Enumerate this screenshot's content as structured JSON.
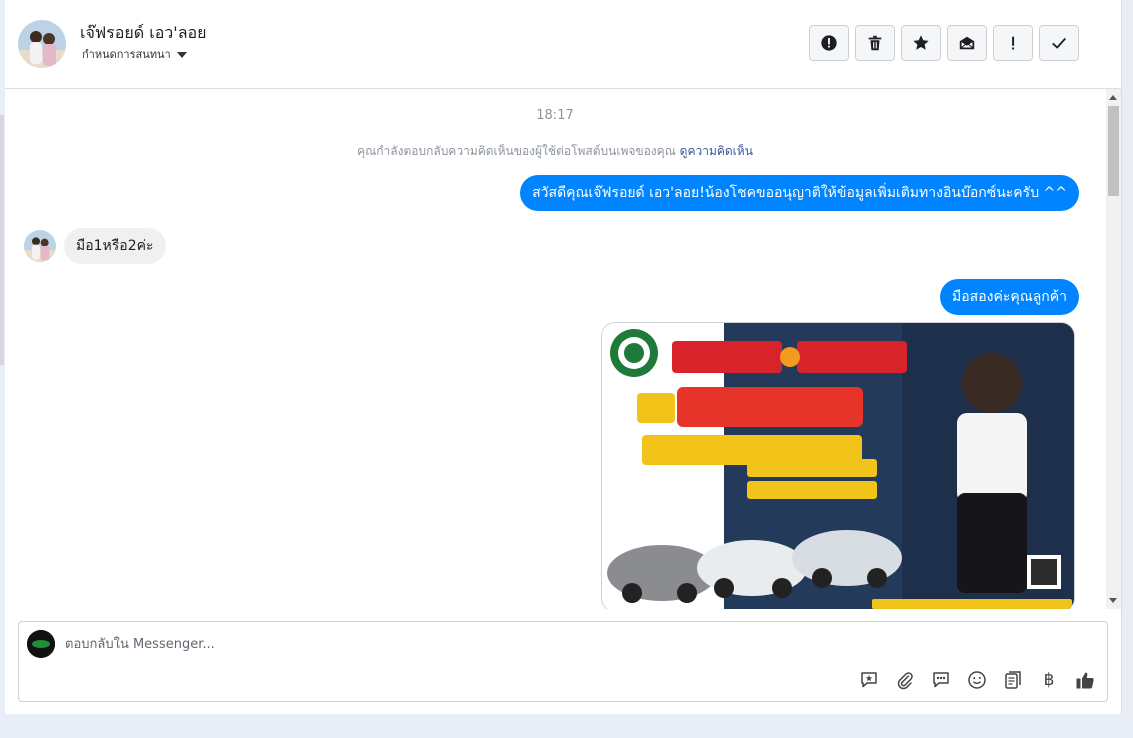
{
  "contact": {
    "name": "เจ๊ฟรอยด์ เอว'ลอย",
    "assign_label": "กำหนดการสนทนา"
  },
  "header_actions": [
    {
      "name": "report-spam-icon",
      "kind": "alert-circle"
    },
    {
      "name": "trash-icon",
      "kind": "trash"
    },
    {
      "name": "star-icon",
      "kind": "star"
    },
    {
      "name": "mark-unread-icon",
      "kind": "envelope-open"
    },
    {
      "name": "follow-up-icon",
      "kind": "exclamation"
    },
    {
      "name": "mark-done-icon",
      "kind": "check"
    }
  ],
  "chat": {
    "timestamp": "18:17",
    "context_text": "คุณกำลังตอบกลับความคิดเห็นของผู้ใช้ต่อโพสต์บนเพจของคุณ",
    "context_link": "ดูความคิดเห็น",
    "messages": [
      {
        "from": "page",
        "text": "สวัสดีคุณเจ๊ฟรอยด์ เอว'ลอย!น้องโชคขออนุญาติให้ข้อมูลเพิ่มเติมทางอินบ๊อกซ์นะครับ ^^"
      },
      {
        "from": "customer",
        "text": "มือ1หรือ2ค่ะ"
      },
      {
        "from": "page",
        "text": "มือสองค่ะคุณลูกค้า"
      },
      {
        "from": "page",
        "type": "image"
      }
    ]
  },
  "composer": {
    "placeholder": "ตอบกลับใน Messenger...",
    "baht_symbol": "฿"
  },
  "colors": {
    "accent": "#0084ff",
    "incoming_bubble": "#f1f0f0",
    "link": "#385898"
  }
}
